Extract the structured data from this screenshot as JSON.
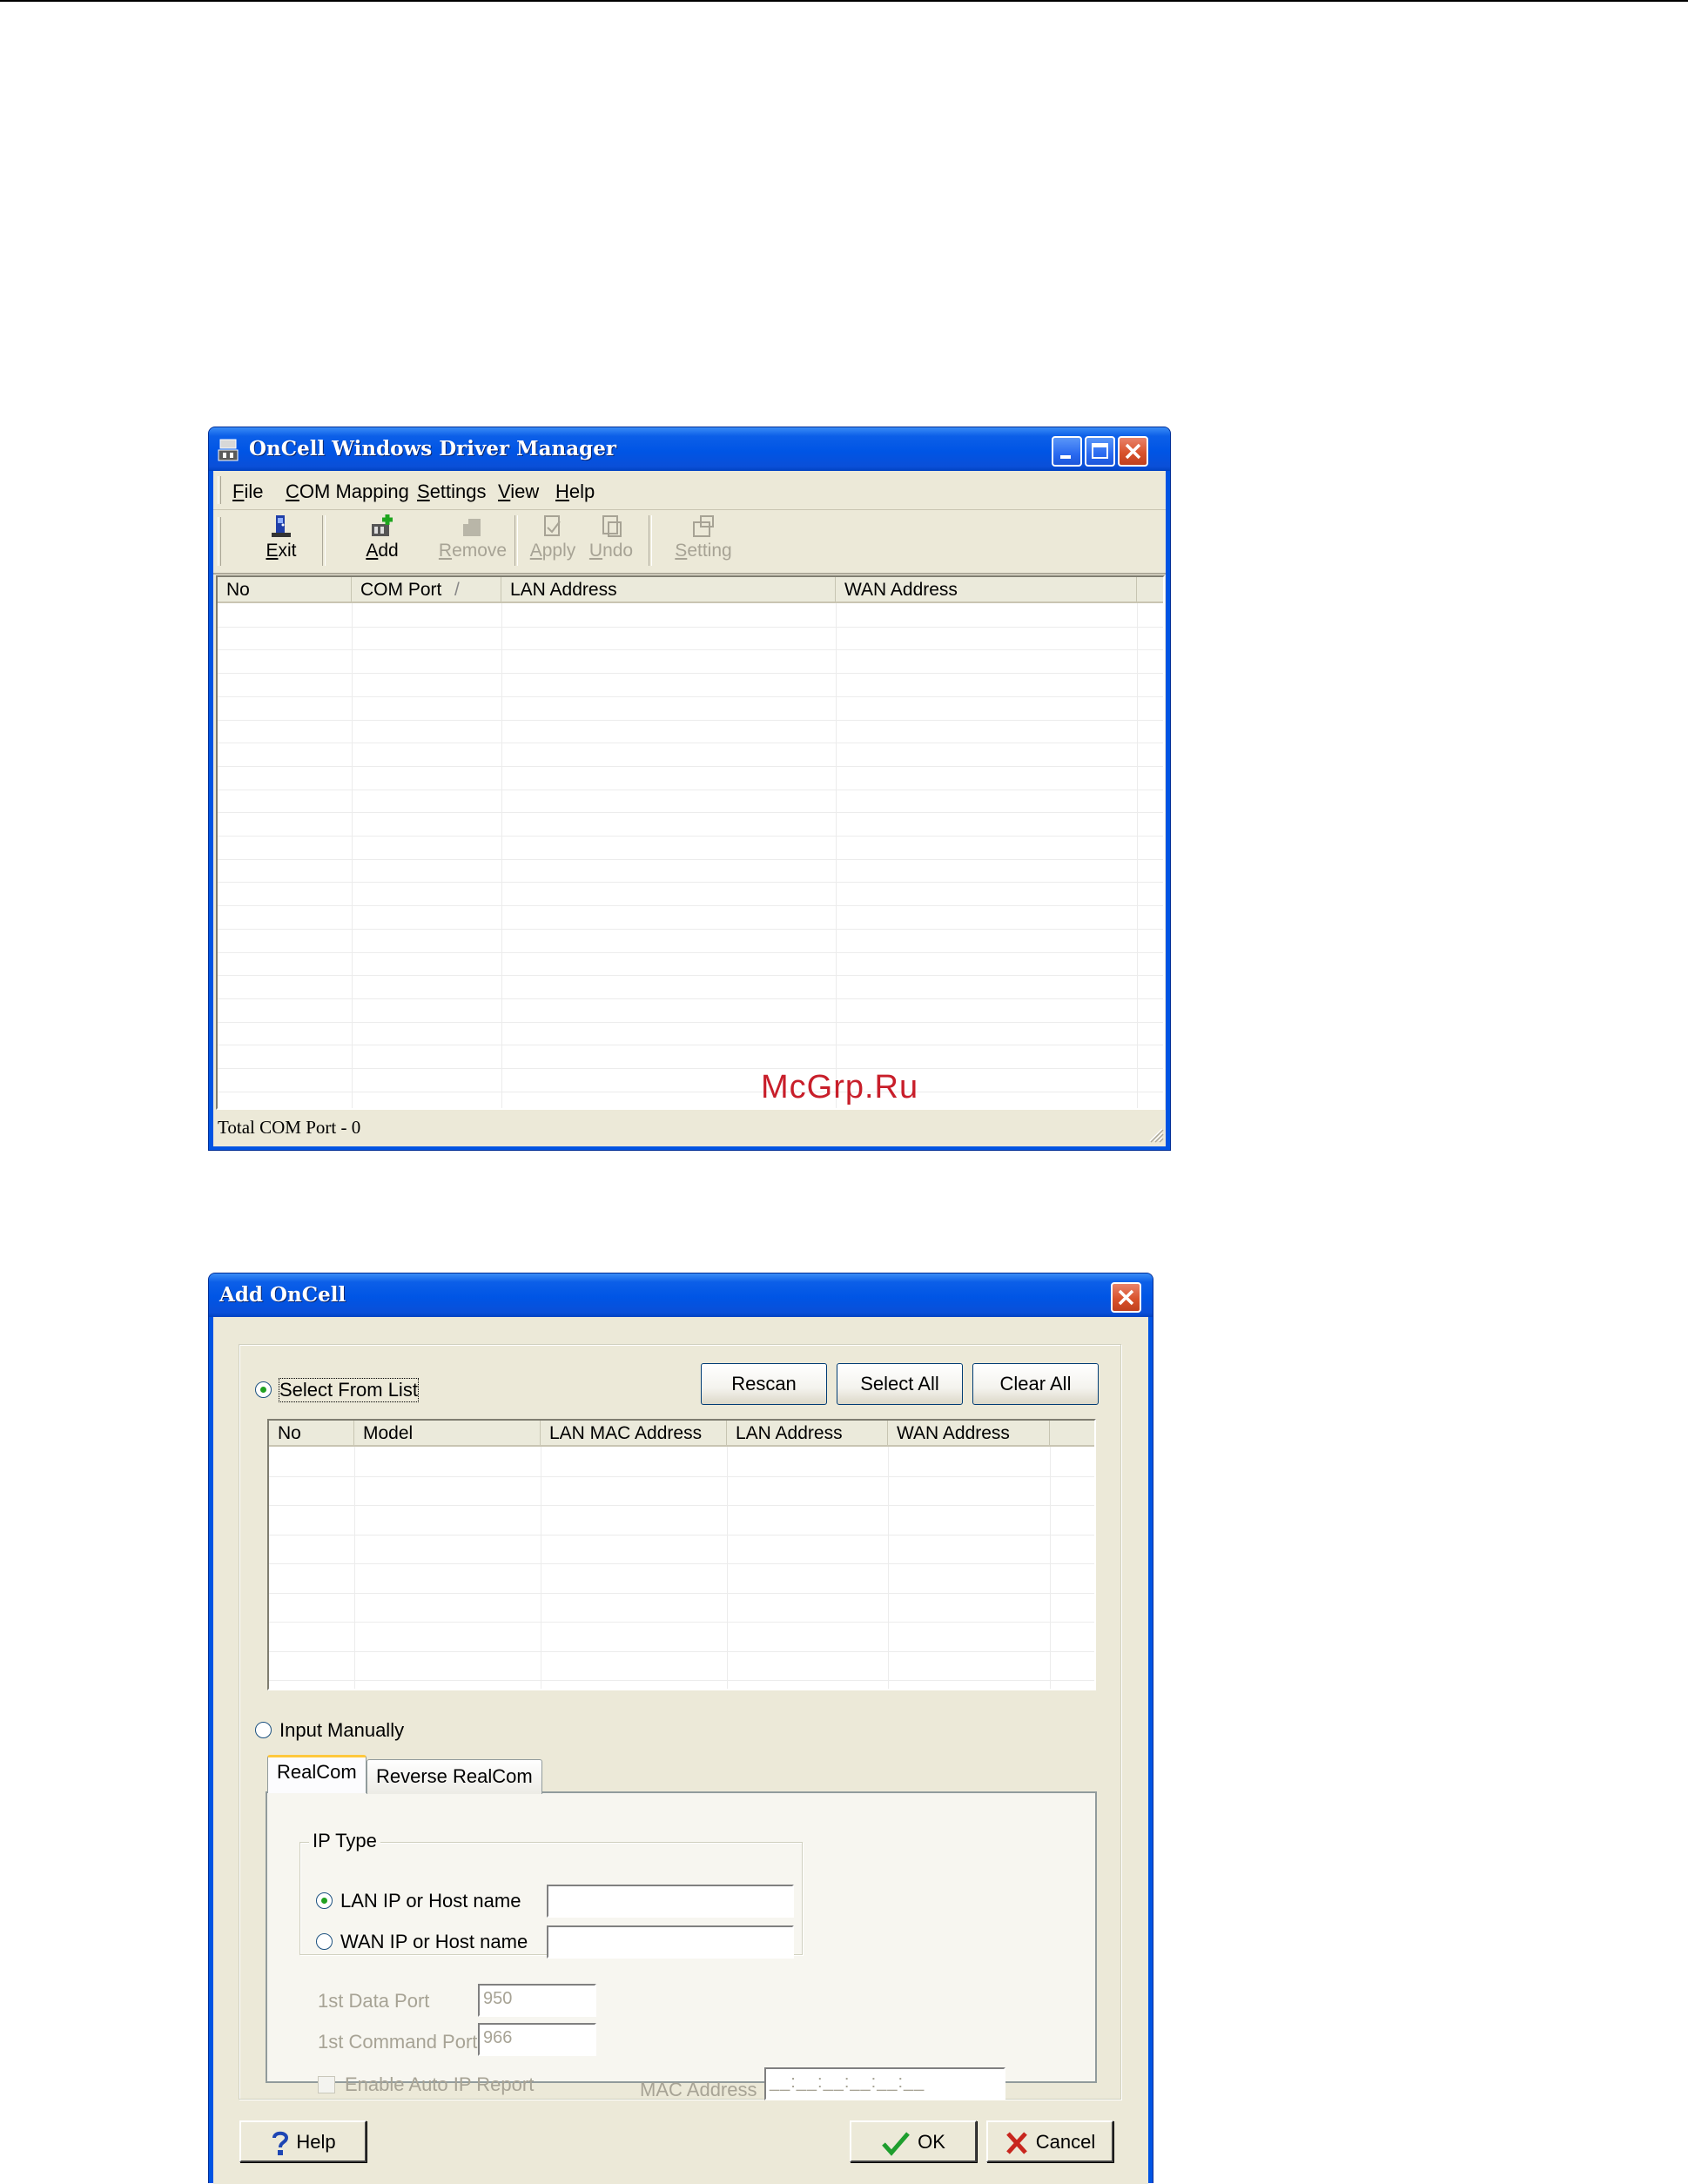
{
  "watermark": "McGrp.Ru",
  "main_window": {
    "title": "OnCell Windows Driver Manager",
    "menu": [
      {
        "u": "F",
        "rest": "ile"
      },
      {
        "u": "C",
        "rest": "OM Mapping"
      },
      {
        "u": "S",
        "rest": "ettings"
      },
      {
        "u": "V",
        "rest": "iew"
      },
      {
        "u": "H",
        "rest": "elp"
      }
    ],
    "toolbar": {
      "exit": {
        "u": "E",
        "rest": "xit",
        "icon": "exit-icon"
      },
      "add": {
        "u": "A",
        "rest": "dd",
        "icon": "add-icon"
      },
      "remove": {
        "u": "R",
        "rest": "emove",
        "icon": "remove-icon"
      },
      "apply": {
        "u": "A",
        "rest": "pply",
        "icon": "apply-icon"
      },
      "undo": {
        "u": "U",
        "rest": "ndo",
        "icon": "undo-icon"
      },
      "setting": {
        "u": "S",
        "rest": "etting",
        "icon": "setting-icon"
      }
    },
    "columns": [
      "No",
      "COM Port",
      "LAN Address",
      "WAN Address"
    ],
    "sort_indicator": "/",
    "status": "Total COM Port - 0"
  },
  "add_dialog": {
    "title": "Add OnCell",
    "select_from_list": "Select From List",
    "buttons": {
      "rescan": "Rescan",
      "select_all": "Select All",
      "clear_all": "Clear All"
    },
    "columns": [
      "No",
      "Model",
      "LAN MAC Address",
      "LAN Address",
      "WAN Address"
    ],
    "input_manually": "Input Manually",
    "tabs": [
      "RealCom",
      "Reverse RealCom"
    ],
    "ip_type": {
      "legend": "IP Type",
      "lan_label": "LAN IP or Host name",
      "wan_label": "WAN IP or Host name",
      "lan_value": "",
      "wan_value": ""
    },
    "data_port_label": "1st Data Port",
    "data_port_value": "950",
    "command_port_label": "1st Command Port",
    "command_port_value": "966",
    "auto_ip_label": "Enable Auto IP Report",
    "mac_label": "MAC Address",
    "mac_value": "__:__:__:__:__:__",
    "help": "Help",
    "ok": "OK",
    "cancel": "Cancel"
  }
}
